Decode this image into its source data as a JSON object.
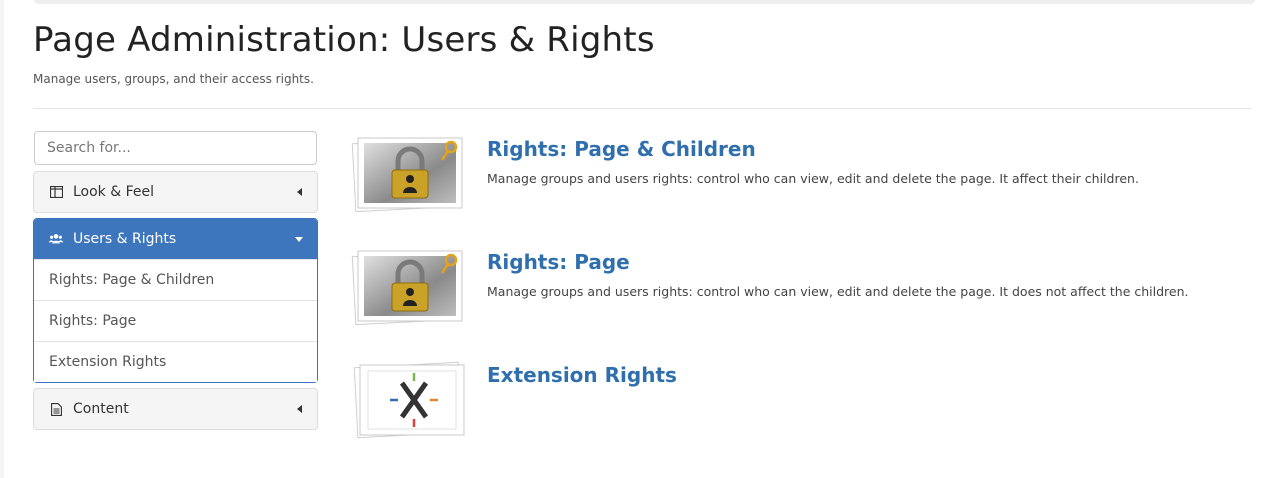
{
  "header": {
    "title": "Page Administration: Users & Rights",
    "subtitle": "Manage users, groups, and their access rights."
  },
  "sidebar": {
    "search_placeholder": "Search for...",
    "panels": [
      {
        "label": "Look & Feel",
        "icon": "layout-columns-icon",
        "state": "collapsed"
      },
      {
        "label": "Users & Rights",
        "icon": "users-icon",
        "state": "expanded",
        "items": [
          {
            "label": "Rights: Page & Children"
          },
          {
            "label": "Rights: Page"
          },
          {
            "label": "Extension Rights"
          }
        ]
      },
      {
        "label": "Content",
        "icon": "document-icon",
        "state": "collapsed"
      }
    ]
  },
  "main": {
    "entries": [
      {
        "title": "Rights: Page & Children",
        "description": "Manage groups and users rights: control who can view, edit and delete the page. It affect their children.",
        "icon": "lock-key-icon"
      },
      {
        "title": "Rights: Page",
        "description": "Manage groups and users rights: control who can view, edit and delete the page. It does not affect the children.",
        "icon": "lock-key-icon"
      },
      {
        "title": "Extension Rights",
        "description": "",
        "icon": "extension-x-icon"
      }
    ]
  },
  "colors": {
    "accent": "#3d76bd",
    "link": "#2f6fad",
    "lock_gold": "#c9a227"
  }
}
